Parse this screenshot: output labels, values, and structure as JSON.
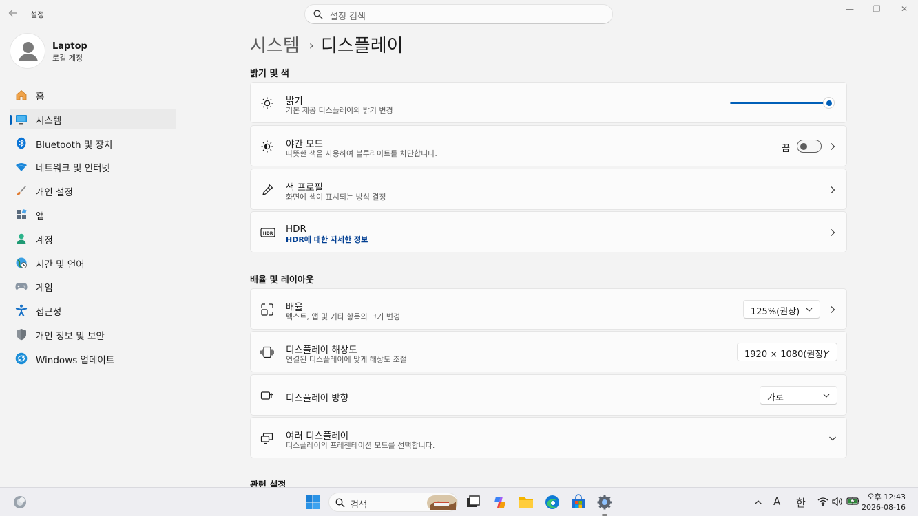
{
  "window": {
    "app_title": "설정",
    "search_placeholder": "설정 검색",
    "minimize": "—",
    "maximize": "❐",
    "close": "✕"
  },
  "profile": {
    "name": "Laptop",
    "account": "로컬 계정"
  },
  "sidebar": {
    "items": [
      {
        "label": "홈",
        "icon": "home-icon"
      },
      {
        "label": "시스템",
        "icon": "system-icon",
        "active": true
      },
      {
        "label": "Bluetooth 및 장치",
        "icon": "bluetooth-icon"
      },
      {
        "label": "네트워크 및 인터넷",
        "icon": "wifi-icon"
      },
      {
        "label": "개인 설정",
        "icon": "brush-icon"
      },
      {
        "label": "앱",
        "icon": "apps-icon"
      },
      {
        "label": "계정",
        "icon": "account-icon"
      },
      {
        "label": "시간 및 언어",
        "icon": "globe-clock-icon"
      },
      {
        "label": "게임",
        "icon": "gamepad-icon"
      },
      {
        "label": "접근성",
        "icon": "accessibility-icon"
      },
      {
        "label": "개인 정보 및 보안",
        "icon": "shield-icon"
      },
      {
        "label": "Windows 업데이트",
        "icon": "update-icon"
      }
    ]
  },
  "breadcrumb": {
    "parent": "시스템",
    "separator": "›",
    "current": "디스플레이"
  },
  "sections": {
    "brightness_color": "밝기 및 색",
    "scale_layout": "배율 및 레이아웃",
    "related": "관련 설정"
  },
  "settings": {
    "brightness": {
      "title": "밝기",
      "desc": "기본 제공 디스플레이의 밝기 변경",
      "value": 100
    },
    "night_light": {
      "title": "야간 모드",
      "desc": "따뜻한 색을 사용하여 블루라이트를 차단합니다.",
      "state": "끔"
    },
    "color_profile": {
      "title": "색 프로필",
      "desc": "화면에 색이 표시되는 방식 결정"
    },
    "hdr": {
      "title": "HDR",
      "link": "HDR에 대한 자세한 정보"
    },
    "scale": {
      "title": "배율",
      "desc": "텍스트, 앱 및 기타 항목의 크기 변경",
      "value": "125%(권장)"
    },
    "resolution": {
      "title": "디스플레이 해상도",
      "desc": "연결된 디스플레이에 맞게 해상도 조절",
      "value": "1920 × 1080(권장)"
    },
    "orientation": {
      "title": "디스플레이 방향",
      "value": "가로"
    },
    "multiple_displays": {
      "title": "여러 디스플레이",
      "desc": "디스플레이의 프레젠테이션 모드를 선택합니다."
    }
  },
  "taskbar": {
    "search_label": "검색",
    "tray_lang_a": "A",
    "tray_ime": "한",
    "clock_time": "오후 12:43",
    "clock_date": "2026-08-16"
  },
  "colors": {
    "accent": "#005fb8",
    "background": "#f3f3f3",
    "card": "#fbfbfb"
  }
}
